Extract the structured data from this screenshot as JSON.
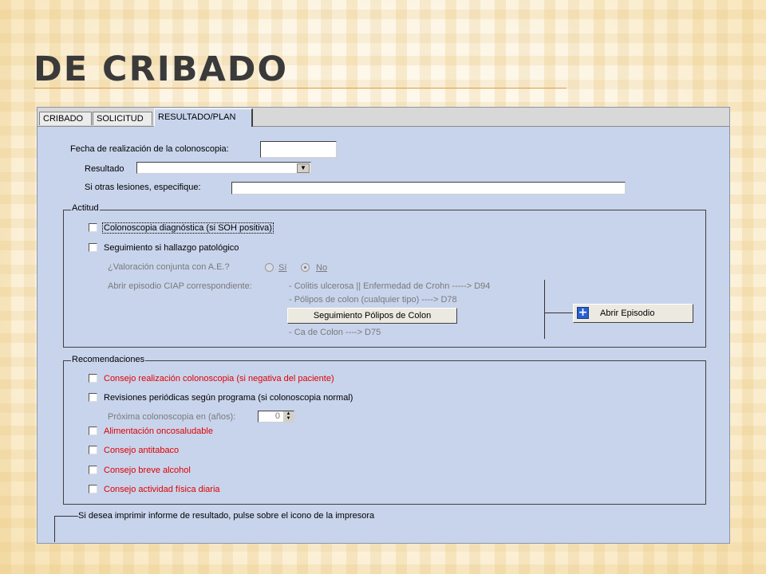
{
  "slide": {
    "title": "DE CRIBADO"
  },
  "tabs": [
    {
      "label": "CRIBADO"
    },
    {
      "label": "SOLICITUD"
    },
    {
      "label": "RESULTADO/PLAN"
    }
  ],
  "form": {
    "fecha_label": "Fecha de realización de la colonoscopia:",
    "fecha_value": "",
    "resultado_label": "Resultado",
    "resultado_value": "",
    "otras_label": "Si otras lesiones, especifique:",
    "otras_value": ""
  },
  "actitud": {
    "legend": "Actitud",
    "items": [
      {
        "label": "Colonoscopia diagnóstica (si SOH positiva)",
        "checked": false
      },
      {
        "label": "Seguimiento si hallazgo patológico",
        "checked": false
      }
    ],
    "valoracion_label": "¿Valoración conjunta con A.E.?",
    "valoracion_options": [
      "Sí",
      "No"
    ],
    "valoracion_selected": "No",
    "ciap_label": "Abrir episodio CIAP correspondiente:",
    "ciap_lines": [
      "- Colitis ulcerosa || Enfermedad de Crohn -----> D94",
      "- Pólipos de colon (cualquier tipo) ----> D78",
      "- Ca de Colon ----> D75"
    ],
    "seguimiento_button": "Seguimiento Pólipos de Colon",
    "abrir_button": "Abrir Episodio"
  },
  "recomendaciones": {
    "legend": "Recomendaciones",
    "items": [
      {
        "label": "Consejo realización colonoscopia (si negativa del paciente)",
        "checked": false,
        "color": "#e00000"
      },
      {
        "label": "Revisiones periódicas según programa (si colonoscopia normal)",
        "checked": false,
        "color": "#000000"
      },
      {
        "label": "Alimentación oncosaludable",
        "checked": false,
        "color": "#e00000"
      },
      {
        "label": "Consejo antitabaco",
        "checked": false,
        "color": "#e00000"
      },
      {
        "label": "Consejo breve alcohol",
        "checked": false,
        "color": "#e00000"
      },
      {
        "label": "Consejo actividad física diaria",
        "checked": false,
        "color": "#e00000"
      }
    ],
    "proxima_label": "Próxima colonoscopia en (años):",
    "proxima_value": "0"
  },
  "imprimir": {
    "legend": "Si desea imprimir informe de resultado, pulse sobre el icono de la impresora"
  },
  "colors": {
    "panel": "#c8d4ec",
    "accent_red": "#e00000",
    "title_rule": "#e0a050",
    "icon_blue": "#2a5fd0"
  }
}
